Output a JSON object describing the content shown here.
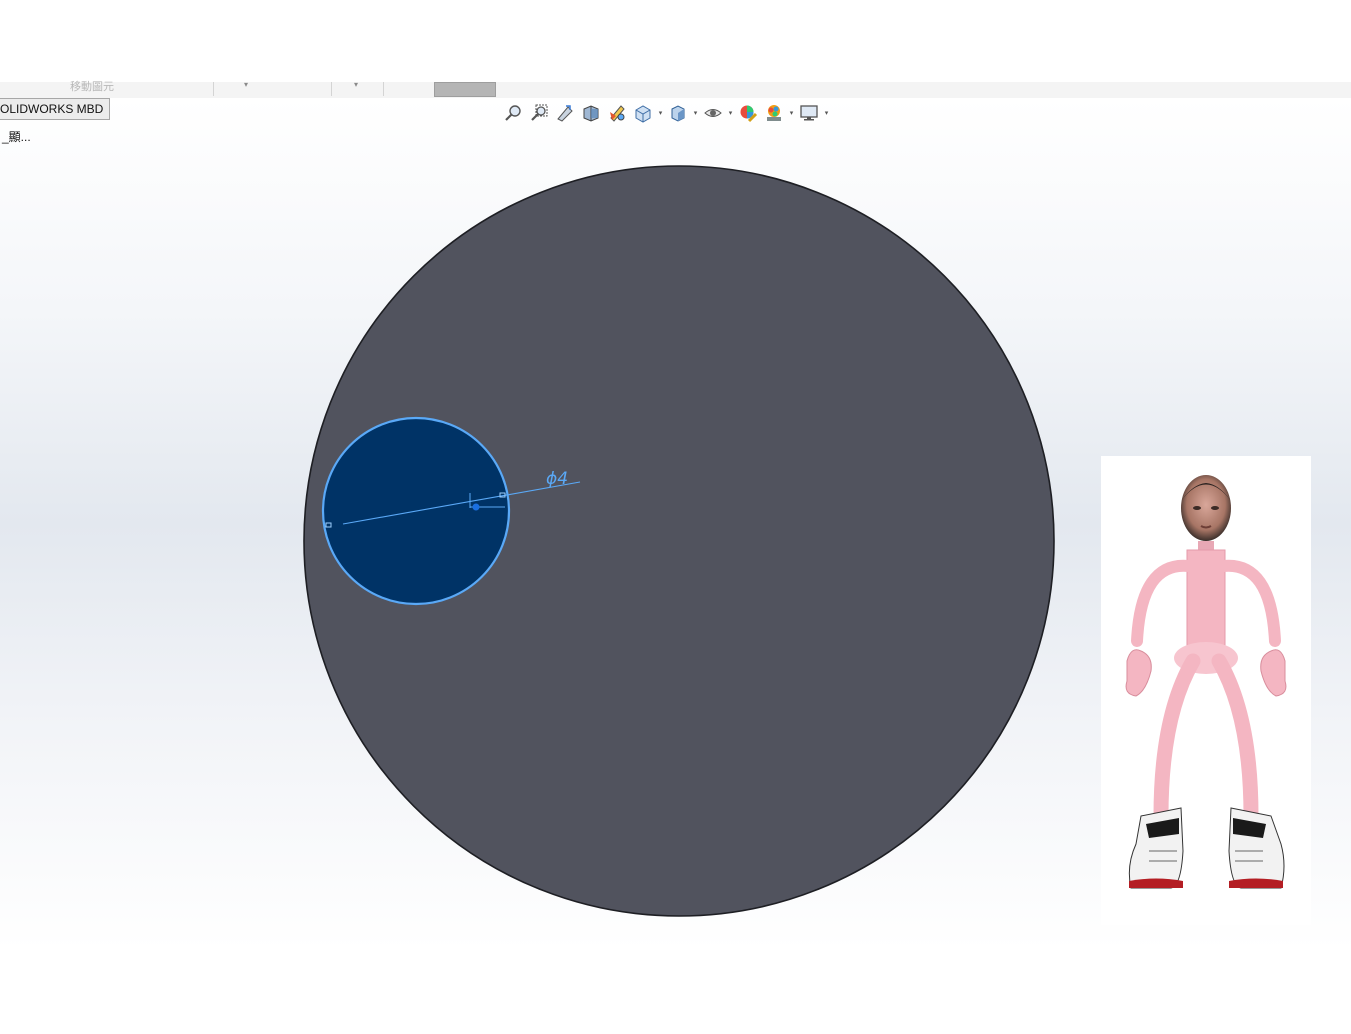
{
  "command_strip": {
    "faded_label": "移動圖元",
    "caret1": "▾",
    "caret2": "▾"
  },
  "tabs": {
    "mbd_label": "OLIDWORKS MBD"
  },
  "feature_tree": {
    "note": "_顯..."
  },
  "heads_up_toolbar": {
    "tools": [
      "zoom-to-fit-icon",
      "zoom-to-area-icon",
      "previous-view-icon",
      "section-view-icon",
      "dynamic-annotation-views-icon",
      "view-orientation-icon",
      "display-style-icon",
      "hide-show-items-icon",
      "edit-appearance-icon",
      "apply-scene-icon",
      "view-settings-icon"
    ],
    "dropdown_glyph": "▾"
  },
  "sketch": {
    "diameter_dimension": "ϕ4"
  },
  "colors": {
    "part_face": "#51535e",
    "sketch_fill": "#003366",
    "sketch_edge": "#5aa9f7",
    "figure_pink": "#f4b6c2"
  }
}
